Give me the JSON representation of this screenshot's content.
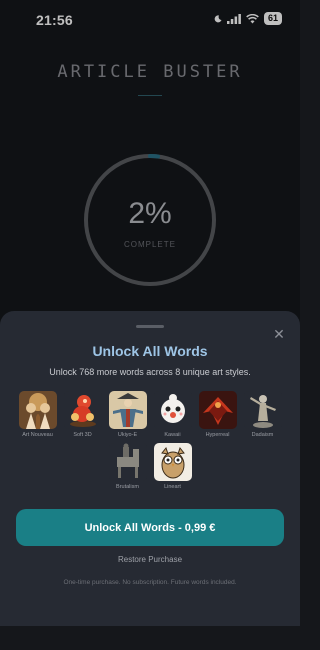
{
  "status_bar": {
    "time": "21:56",
    "battery": "61",
    "icons": [
      "moon-icon",
      "signal-icon",
      "wifi-icon",
      "battery-icon"
    ]
  },
  "app": {
    "title": "ARTICLE BUSTER",
    "progress_percent_label": "2%",
    "progress_fraction": 0.02,
    "progress_caption": "COMPLETE"
  },
  "sheet": {
    "title": "Unlock All Words",
    "subtitle": "Unlock 768 more words across 8 unique art styles.",
    "styles": [
      {
        "label": "Art Nouveau"
      },
      {
        "label": "Soft 3D"
      },
      {
        "label": "Ukiyo-E"
      },
      {
        "label": "Kawaii"
      },
      {
        "label": "Hyperreal"
      },
      {
        "label": "Dadaism"
      },
      {
        "label": "Brutalism"
      },
      {
        "label": "Lineart"
      }
    ],
    "unlock_button": "Unlock All Words - 0,99 €",
    "restore_link": "Restore Purchase",
    "footnote": "One-time purchase. No subscription. Future words included.",
    "close_icon": "close-icon"
  },
  "colors": {
    "accent": "#1a7f86",
    "title_blue": "#9ec5e6",
    "sheet_bg": "#262a33",
    "page_bg": "#15171b"
  }
}
